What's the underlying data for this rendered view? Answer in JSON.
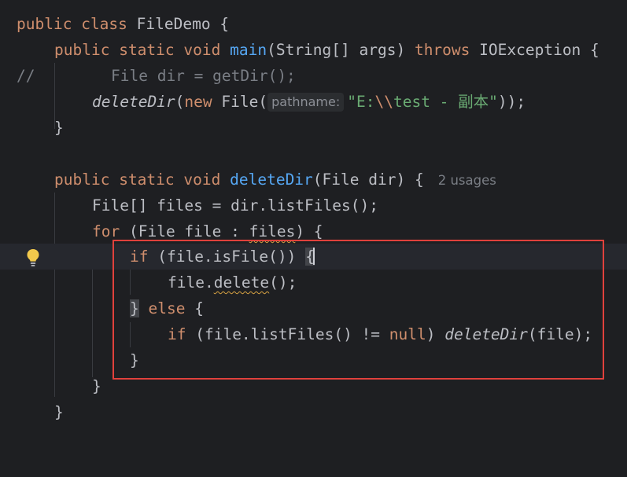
{
  "editor": {
    "lines": {
      "l1": {
        "kw1": "public",
        "kw2": "class",
        "name": "FileDemo",
        "brace": "{"
      },
      "l2": {
        "kw1": "public",
        "kw2": "static",
        "kw3": "void",
        "fn": "main",
        "params": "(String[] args)",
        "throws": "throws",
        "exc": "IOException",
        "brace": "{"
      },
      "l3": {
        "marker": "//",
        "comment": "File dir = getDir();"
      },
      "l4": {
        "call": "deleteDir",
        "open": "(",
        "new": "new",
        "cls": "File(",
        "hint": "pathname:",
        "str_open": "\"E:",
        "esc": "\\\\",
        "str_rest": "test - 副本\"",
        "close": "));"
      },
      "l5": {
        "brace": "}"
      },
      "l7": {
        "kw1": "public",
        "kw2": "static",
        "kw3": "void",
        "fn": "deleteDir",
        "params": "(File dir)",
        "brace": "{",
        "usages": "2 usages"
      },
      "l8": {
        "text": "File[] files = dir.listFiles();"
      },
      "l9": {
        "for": "for",
        "pre": "(File file : ",
        "var": "files",
        "post": ") {"
      },
      "l10": {
        "if": "if",
        "cond": "(file.isFile())",
        "brace": "{"
      },
      "l11": {
        "pre": "file.",
        "method": "delete",
        "post": "();"
      },
      "l12": {
        "brace": "}",
        "else": "else",
        "open": "{"
      },
      "l13": {
        "if": "if",
        "pre": "(file.listFiles() != ",
        "null": "null",
        "mid": ") ",
        "call": "deleteDir",
        "post": "(file);"
      },
      "l14": {
        "brace": "}"
      },
      "l15": {
        "brace": "}"
      },
      "l16": {
        "brace": "}"
      }
    },
    "colors": {
      "background": "#1e1f22",
      "keyword": "#cf8e6d",
      "function": "#56a8f5",
      "string": "#6aab73",
      "comment": "#7a7e85",
      "highlight_box": "#e0413c",
      "bulb": "#f2c94c"
    },
    "icons": {
      "gutter": "lightbulb-icon"
    }
  }
}
